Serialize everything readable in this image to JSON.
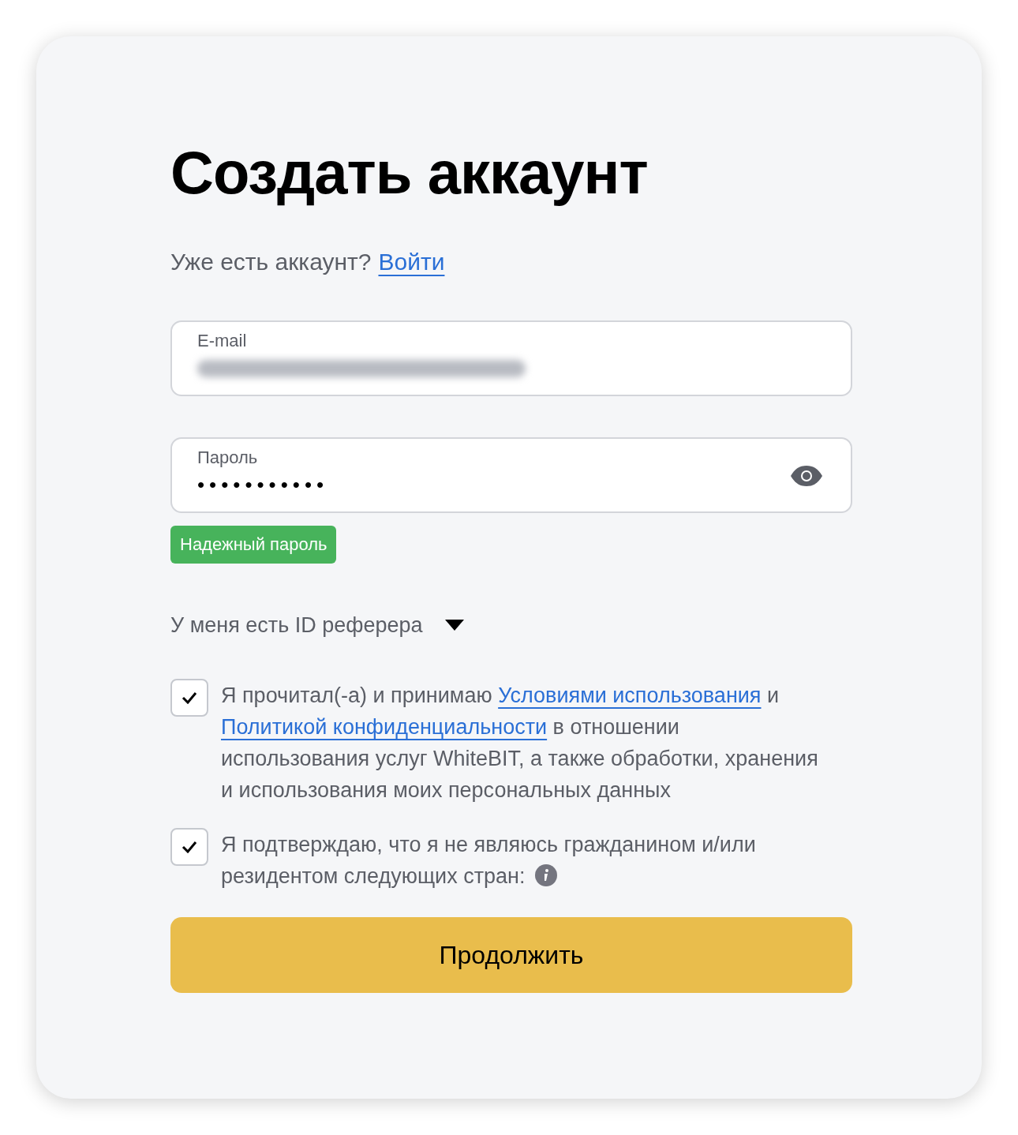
{
  "title": "Создать аккаунт",
  "signin_prompt": {
    "text": "Уже есть аккаунт?",
    "link": "Войти"
  },
  "fields": [
    {
      "kind": "email",
      "label": "E-mail",
      "value_blurred": true
    },
    {
      "kind": "password",
      "label": "Пароль",
      "value": "•••••••••••"
    }
  ],
  "strength_badge": "Надежный пароль",
  "referrer_toggle": {
    "label": "У меня есть ID реферера",
    "expanded": false
  },
  "consents": [
    {
      "checked": true,
      "info_icon": false,
      "parts": [
        {
          "kind": "text",
          "text": "Я прочитал(-а) и принимаю "
        },
        {
          "kind": "link",
          "text": "Условиями использования"
        },
        {
          "kind": "text",
          "text": " и "
        },
        {
          "kind": "link",
          "text": "Политикой конфиденциальности"
        },
        {
          "kind": "text",
          "text": " в отношении использования услуг WhiteBIT, а также обработки, хранения и использования моих персональных данных"
        }
      ]
    },
    {
      "checked": true,
      "info_icon": true,
      "parts": [
        {
          "kind": "text",
          "text": "Я подтверждаю, что я не являюсь гражданином и/или резидентом следующих стран:"
        }
      ]
    }
  ],
  "submit_button": "Продолжить"
}
